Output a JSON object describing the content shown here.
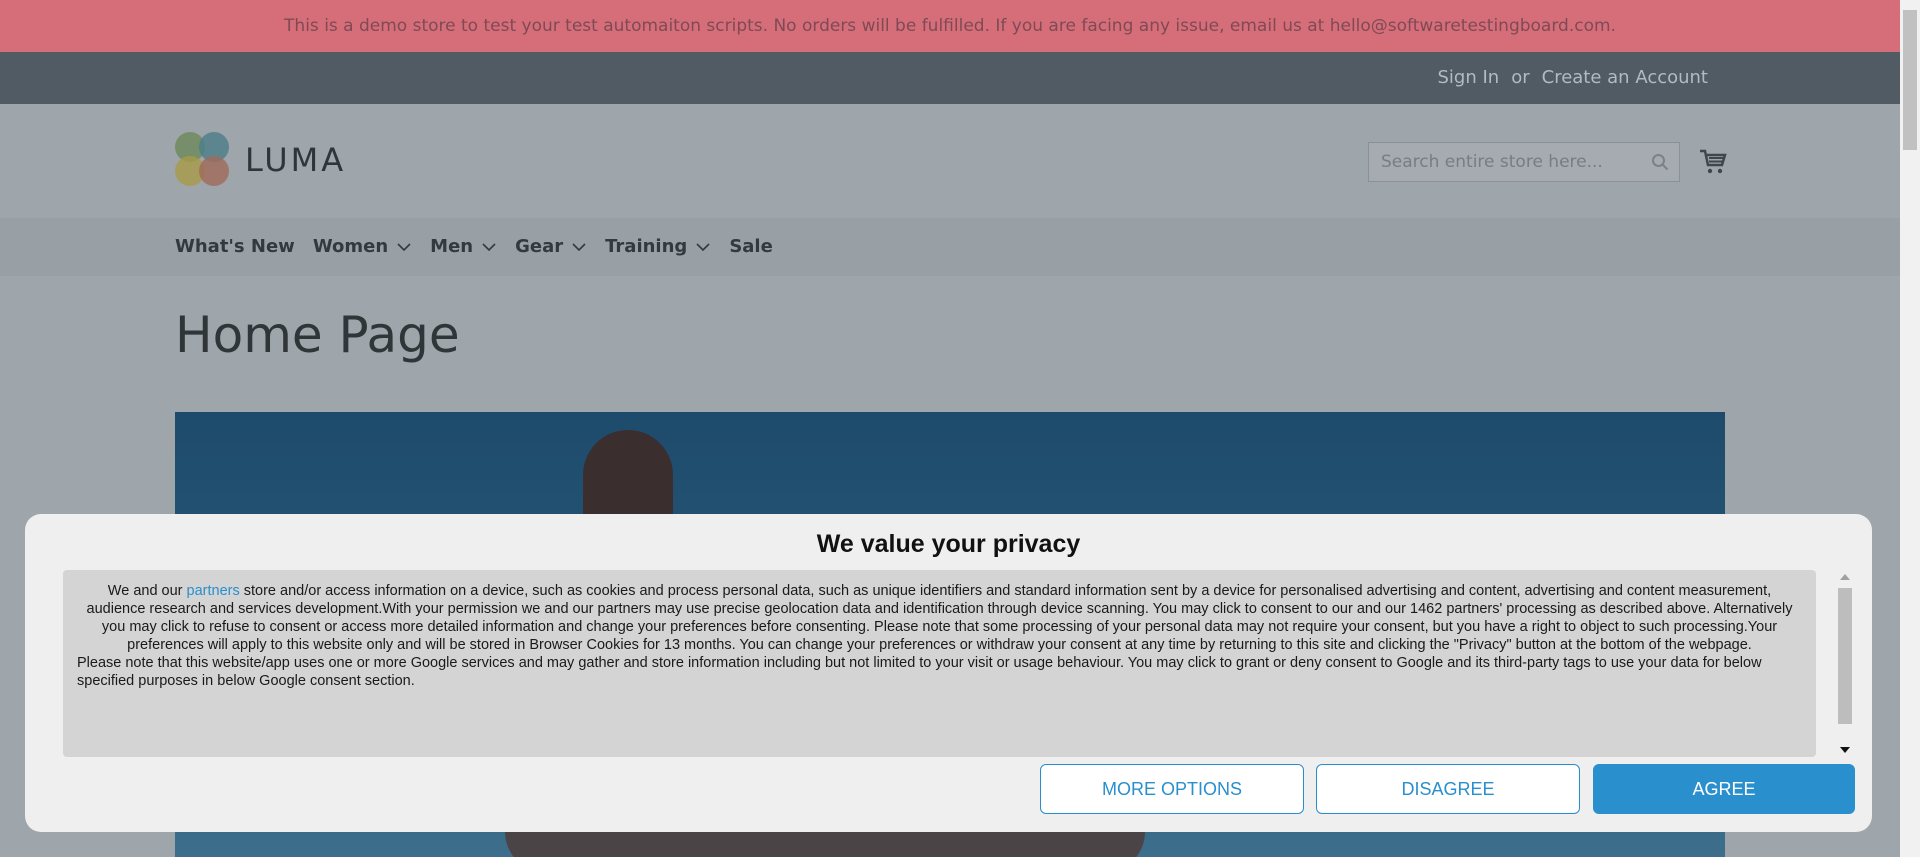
{
  "demo_banner": {
    "text": "This is a demo store to test your test automaiton scripts. No orders will be fulfilled. If you are facing any issue, email us at hello@softwaretestingboard.com."
  },
  "header": {
    "sign_in": "Sign In",
    "or": "or",
    "create_account": "Create an Account"
  },
  "logo": {
    "text": "LUMA"
  },
  "search": {
    "placeholder": "Search entire store here..."
  },
  "nav": {
    "items": [
      {
        "label": "What's New",
        "has_dropdown": false
      },
      {
        "label": "Women",
        "has_dropdown": true
      },
      {
        "label": "Men",
        "has_dropdown": true
      },
      {
        "label": "Gear",
        "has_dropdown": true
      },
      {
        "label": "Training",
        "has_dropdown": true
      },
      {
        "label": "Sale",
        "has_dropdown": false
      }
    ]
  },
  "page": {
    "title": "Home Page"
  },
  "consent": {
    "title": "We value your privacy",
    "p1_before_link": "We and our ",
    "p1_link": "partners",
    "p1_after_link": " store and/or access information on a device, such as cookies and process personal data, such as unique identifiers and standard information sent by a device for personalised advertising and content, advertising and content measurement, audience research and services development.With your permission we and our partners may use precise geolocation data and identification through device scanning. You may click to consent to our and our 1462 partners' processing as described above. Alternatively you may click to refuse to consent or access more detailed information and change your preferences before consenting. Please note that some processing of your personal data may not require your consent, but you have a right to object to such processing.Your preferences will apply to this website only and will be stored in Browser Cookies for 13 months. You can change your preferences or withdraw your consent at any time by returning to this site and clicking the \"Privacy\" button at the bottom of the webpage.",
    "p2": "Please note that this website/app uses one or more Google services and may gather and store information including but not limited to your visit or usage behaviour. You may click to grant or deny consent to Google and its third-party tags to use your data for below specified purposes in below Google consent section.",
    "buttons": {
      "more_options": "MORE OPTIONS",
      "disagree": "DISAGREE",
      "agree": "AGREE"
    }
  },
  "colors": {
    "banner_bg": "#d66e79",
    "accent": "#2a8fcd",
    "overlay_page": "#9ea5ab"
  },
  "icons": {
    "search": "search-icon",
    "cart": "cart-icon",
    "chevron": "chevron-down-icon"
  }
}
